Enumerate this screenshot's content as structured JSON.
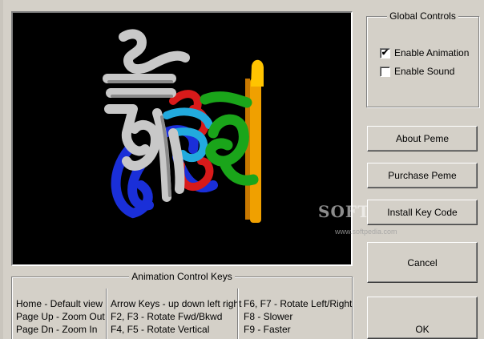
{
  "global_controls": {
    "title": "Global Controls",
    "enable_animation": {
      "label": "Enable Animation",
      "checked": true,
      "mark": "✔"
    },
    "enable_sound": {
      "label": "Enable Sound",
      "checked": false,
      "mark": ""
    }
  },
  "buttons": {
    "about": "About Peme",
    "purchase": "Purchase Peme",
    "install_key": "Install Key Code",
    "cancel": "Cancel",
    "ok": "OK"
  },
  "animation_keys": {
    "title": "Animation Control Keys",
    "col1": [
      "Home - Default view",
      "Page Up - Zoom Out",
      "Page Dn - Zoom In"
    ],
    "col2": [
      "Arrow Keys - up down left right",
      "F2, F3 - Rotate Fwd/Bkwd",
      "F4, F5 - Rotate Vertical"
    ],
    "col3": [
      "F6, F7 - Rotate Left/Right",
      "F8 - Slower",
      "F9 - Faster"
    ]
  },
  "watermark": {
    "text": "SOFTPEDIA",
    "url": "www.softpedia.com"
  },
  "colors": {
    "background": "#d4d0c8",
    "viewport": "#000000",
    "glyph_silver": "#c8c8c8",
    "glyph_green": "#1aa51a",
    "glyph_blue": "#1a2fd8",
    "glyph_red": "#d81a1a",
    "glyph_cyan": "#22aadd",
    "glyph_orange": "#f0a000"
  }
}
